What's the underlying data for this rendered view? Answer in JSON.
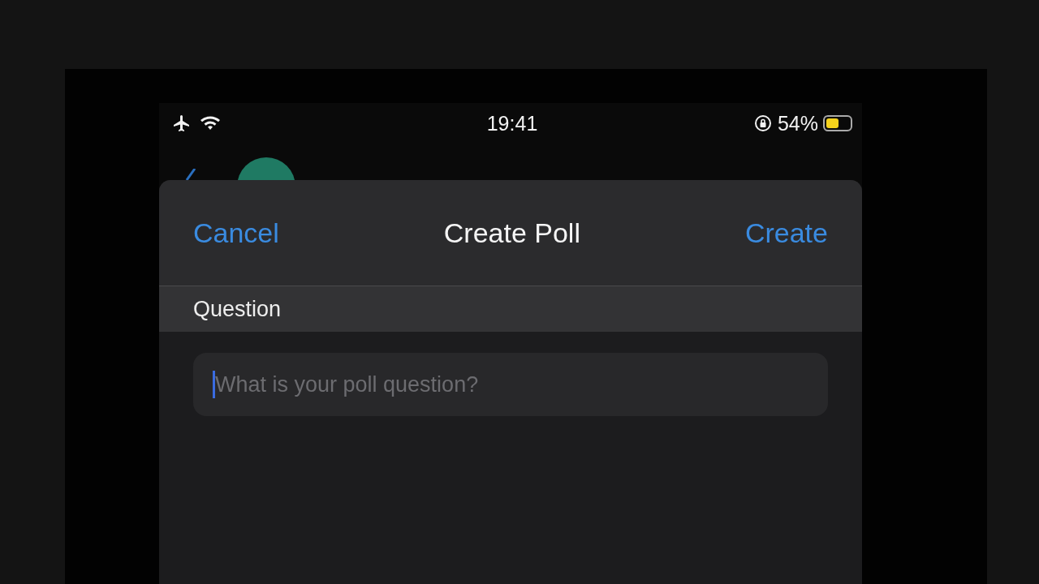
{
  "status_bar": {
    "time": "19:41",
    "battery_text": "54%"
  },
  "sheet": {
    "cancel": "Cancel",
    "title": "Create Poll",
    "create": "Create"
  },
  "section": {
    "title": "Question"
  },
  "question_field": {
    "placeholder": "What is your poll question?"
  }
}
